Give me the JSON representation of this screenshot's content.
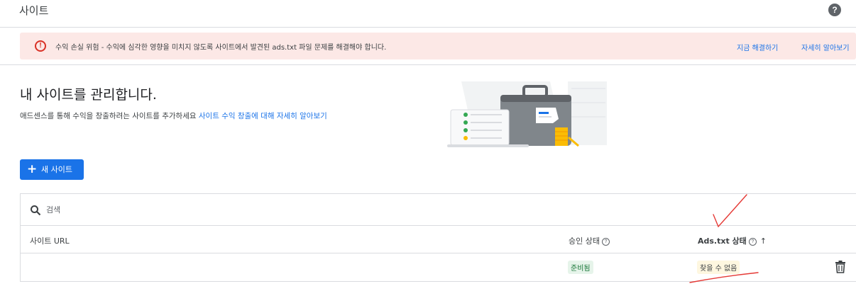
{
  "header": {
    "title": "사이트",
    "help_icon": "help-icon",
    "help_glyph": "?"
  },
  "alert": {
    "icon": "error-icon",
    "icon_glyph": "!",
    "color": "#d93025",
    "background": "#fce8e6",
    "message": "수익 손실 위험 - 수익에 심각한 영향을 미치지 않도록 사이트에서 발견된 ads.txt 파일 문제를 해결해야 합니다.",
    "fix_link": "지금 해결하기",
    "learn_link": "자세히 알아보기"
  },
  "intro": {
    "title": "내 사이트를 관리합니다.",
    "description": "애드센스를 통해 수익을 창출하려는 사이트를 추가하세요 ",
    "learn_link": "사이트 수익 창출에 대해 자세히 알아보기"
  },
  "new_site_button": {
    "icon": "plus-icon",
    "label": "새 사이트",
    "color": "#1a73e8"
  },
  "table": {
    "search": {
      "icon": "search-icon",
      "placeholder": "검색"
    },
    "columns": {
      "url": "사이트 URL",
      "approval": "승인 상태",
      "ads_txt": "Ads.txt 상태"
    },
    "rows": [
      {
        "url": "",
        "approval_status": "준비됨",
        "ads_txt_status": "찾을 수 없음",
        "delete_icon": "trash-icon"
      }
    ]
  },
  "colors": {
    "accent": "#1a73e8",
    "ready_badge": "#e6f4ea",
    "not_found_badge": "#fef7e0",
    "annotation": "#e53935"
  }
}
